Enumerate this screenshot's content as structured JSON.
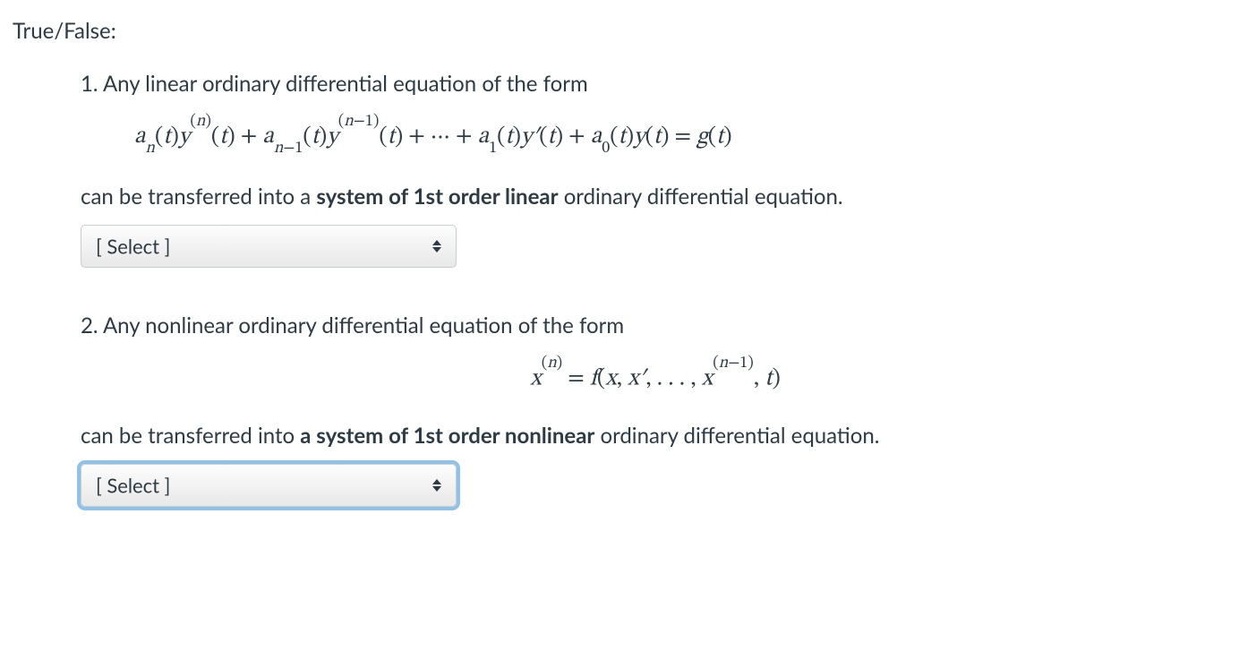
{
  "header": "True/False:",
  "questions": [
    {
      "number": "1.",
      "intro": "Any linear ordinary differential equation of the form",
      "statement_pre": "can be transferred into a ",
      "statement_bold": "system of 1st order linear",
      "statement_post": " ordinary differential equation.",
      "select_placeholder": "[ Select ]"
    },
    {
      "number": "2.",
      "intro": "Any nonlinear ordinary differential equation of the form",
      "statement_pre": "can be transferred into ",
      "statement_bold": "a system of 1st order nonlinear",
      "statement_post": " ordinary differential equation.",
      "select_placeholder": "[ Select ]"
    }
  ]
}
